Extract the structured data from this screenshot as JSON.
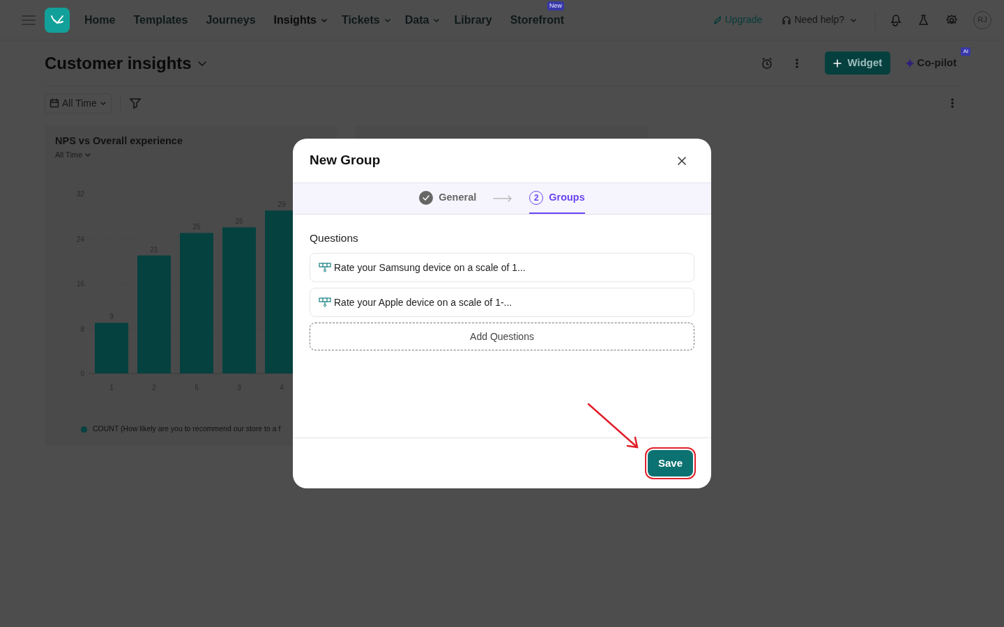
{
  "nav": {
    "items": [
      {
        "label": "Home",
        "selected": false,
        "dropdown": false
      },
      {
        "label": "Templates",
        "selected": false,
        "dropdown": false
      },
      {
        "label": "Journeys",
        "selected": false,
        "dropdown": false
      },
      {
        "label": "Insights",
        "selected": true,
        "dropdown": true
      },
      {
        "label": "Tickets",
        "selected": false,
        "dropdown": true
      },
      {
        "label": "Data",
        "selected": false,
        "dropdown": true
      },
      {
        "label": "Library",
        "selected": false,
        "dropdown": false
      },
      {
        "label": "Storefront",
        "selected": false,
        "dropdown": false,
        "badge": "New"
      }
    ],
    "upgrade": "Upgrade",
    "help": "Need help?",
    "avatar": "RJ"
  },
  "page": {
    "title": "Customer insights",
    "widget_button": "Widget",
    "copilot": {
      "label": "Co-pilot",
      "badge": "AI"
    },
    "filter": "All Time"
  },
  "widgets": [
    {
      "title": "NPS vs Overall experience",
      "period": "All Time",
      "chart_data": {
        "type": "bar",
        "categories": [
          "1",
          "2",
          "5",
          "3",
          "4"
        ],
        "series": [
          {
            "name": "COUNT (How likely are you to recommend our store to a f",
            "color": "#05413f",
            "values": [
              9,
              21,
              25,
              26,
              29
            ]
          }
        ],
        "ylim": [
          0,
          32
        ],
        "yticks": [
          0,
          8,
          16,
          24,
          32
        ],
        "grid": true,
        "data_labels": true
      }
    }
  ],
  "modal": {
    "title": "New Group",
    "steps": [
      {
        "label": "General",
        "done": true,
        "selected": false
      },
      {
        "label": "Groups",
        "number": "2",
        "done": false,
        "selected": true
      }
    ],
    "section_label": "Questions",
    "questions": [
      "Rate your Samsung device on a scale of 1...",
      "Rate your Apple device on a scale of 1-..."
    ],
    "add_button": "Add Questions",
    "save_button": {
      "label": "Save",
      "highlighted": true
    }
  }
}
